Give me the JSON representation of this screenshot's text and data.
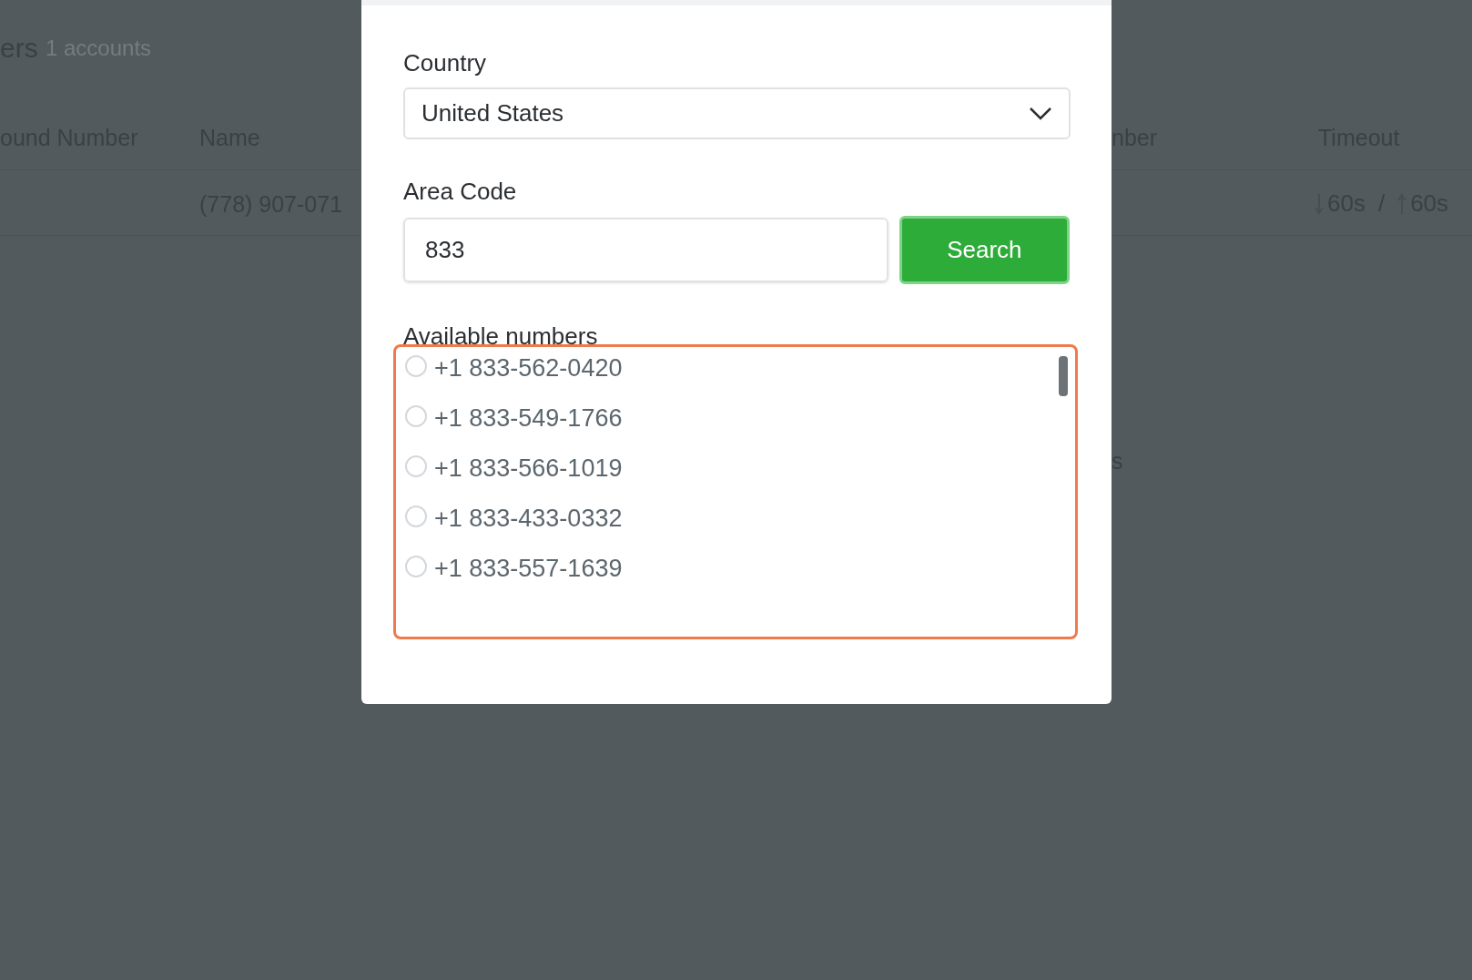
{
  "background": {
    "title": "ers",
    "subtitle": "1 accounts",
    "columns": [
      {
        "label": "ound Number"
      },
      {
        "label": "Name"
      },
      {
        "label": "nber"
      },
      {
        "label": "Timeout"
      }
    ],
    "row": {
      "name": "(778) 907-071",
      "timeout_in": "60s",
      "separator": "/",
      "timeout_out": "60s"
    },
    "stray_text": "s"
  },
  "dialog": {
    "country": {
      "label": "Country",
      "value": "United States"
    },
    "area_code": {
      "label": "Area Code",
      "value": "833",
      "button": "Search"
    },
    "numbers": {
      "label": "Available numbers",
      "items": [
        {
          "number": "+1 833-562-0420",
          "selected": false
        },
        {
          "number": "+1 833-549-1766",
          "selected": false
        },
        {
          "number": "+1 833-566-1019",
          "selected": false
        },
        {
          "number": "+1 833-433-0332",
          "selected": false
        },
        {
          "number": "+1 833-557-1639",
          "selected": false
        }
      ]
    }
  }
}
